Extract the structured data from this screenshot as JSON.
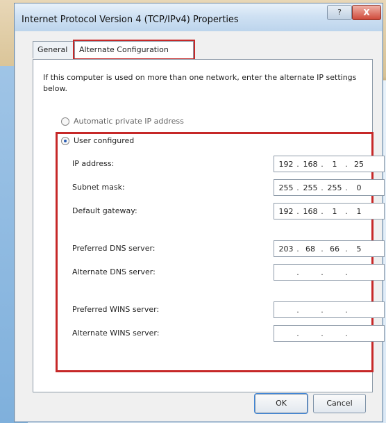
{
  "window": {
    "title": "Internet Protocol Version 4 (TCP/IPv4) Properties"
  },
  "title_buttons": {
    "help_label": "?",
    "close_label": "X"
  },
  "tabs": [
    {
      "label": "General"
    },
    {
      "label": "Alternate Configuration"
    }
  ],
  "intro_text": "If this computer is used on more than one network, enter the alternate IP settings below.",
  "radios": {
    "auto_label": "Automatic private IP address",
    "user_label": "User configured"
  },
  "fields": [
    {
      "label": "IP address:",
      "octets": [
        "192",
        "168",
        "1",
        "25"
      ]
    },
    {
      "label": "Subnet mask:",
      "octets": [
        "255",
        "255",
        "255",
        "0"
      ]
    },
    {
      "label": "Default gateway:",
      "octets": [
        "192",
        "168",
        "1",
        "1"
      ]
    },
    {
      "label": "Preferred DNS server:",
      "octets": [
        "203",
        "68",
        "66",
        "5"
      ]
    },
    {
      "label": "Alternate DNS server:",
      "octets": [
        "",
        "",
        "",
        ""
      ]
    },
    {
      "label": "Preferred WINS server:",
      "octets": [
        "",
        "",
        "",
        ""
      ]
    },
    {
      "label": "Alternate WINS server:",
      "octets": [
        "",
        "",
        "",
        ""
      ]
    }
  ],
  "buttons": {
    "ok_label": "OK",
    "cancel_label": "Cancel"
  }
}
